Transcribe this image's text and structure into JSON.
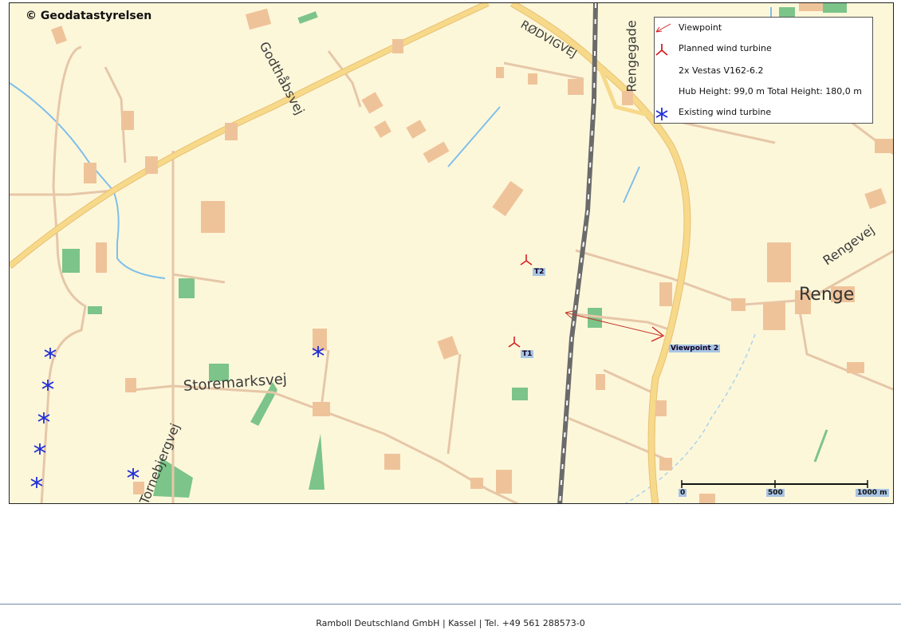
{
  "map": {
    "copyright": "© Geodatastyrelsen",
    "road_labels": {
      "godthabsvej": "Godthåbsvej",
      "rodvigvej": "RØDVIGVEJ",
      "rengegade": "Rengegade",
      "rengevej": "Rengevej",
      "storemarksvej": "Storemarksvej",
      "tornebjergvej": "Tornebjergvej"
    },
    "place_label": "Renge",
    "turbine_labels": {
      "t1": "T1",
      "t2": "T2"
    },
    "viewpoint_label": "Viewpoint 2",
    "scale": {
      "zero": "0",
      "mid": "500",
      "max": "1000 m"
    }
  },
  "legend": {
    "viewpoint": "Viewpoint",
    "planned": "Planned wind turbine",
    "model": "2x Vestas V162-6.2",
    "heights": "Hub Height: 99,0 m Total Height: 180,0 m",
    "existing": "Existing wind turbine"
  },
  "colors": {
    "background": "#fdf7da",
    "main_road": "#f7d98a",
    "minor_road": "#e6c7a8",
    "building": "#efc39a",
    "woodland": "#7cc489",
    "water": "#7fbfe9",
    "planned_turbine": "#d62020",
    "existing_turbine": "#2230d6"
  },
  "footer": {
    "text": "Ramboll Deutschland GmbH | Kassel | Tel. +49 561 288573-0"
  }
}
